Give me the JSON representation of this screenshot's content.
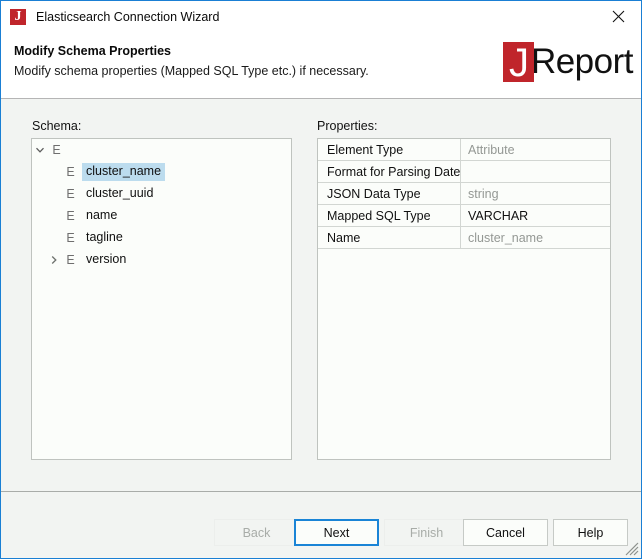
{
  "window": {
    "title": "Elasticsearch Connection Wizard",
    "app_icon": "jreport-j-icon",
    "close_icon": "close-icon",
    "accent_color": "#1a7fd4",
    "brand_red": "#c0252b",
    "selection_color": "#bcdcee"
  },
  "header": {
    "title": "Modify Schema Properties",
    "subtitle": "Modify schema properties (Mapped SQL Type etc.) if necessary.",
    "logo_mark": "J",
    "logo_word": "Report"
  },
  "schema": {
    "label": "Schema:",
    "tree": [
      {
        "label": "",
        "tag": "E",
        "level": 0,
        "expanded": true,
        "has_children": true,
        "selected": false
      },
      {
        "label": "cluster_name",
        "tag": "E",
        "level": 1,
        "expanded": false,
        "has_children": false,
        "selected": true
      },
      {
        "label": "cluster_uuid",
        "tag": "E",
        "level": 1,
        "expanded": false,
        "has_children": false,
        "selected": false
      },
      {
        "label": "name",
        "tag": "E",
        "level": 1,
        "expanded": false,
        "has_children": false,
        "selected": false
      },
      {
        "label": "tagline",
        "tag": "E",
        "level": 1,
        "expanded": false,
        "has_children": false,
        "selected": false
      },
      {
        "label": "version",
        "tag": "E",
        "level": 1,
        "expanded": false,
        "has_children": true,
        "selected": false
      }
    ]
  },
  "properties": {
    "label": "Properties:",
    "rows": [
      {
        "name": "Element Type",
        "value": "Attribute",
        "editable": false
      },
      {
        "name": "Format for Parsing Date/T...",
        "value": "",
        "editable": true
      },
      {
        "name": "JSON Data Type",
        "value": "string",
        "editable": false
      },
      {
        "name": "Mapped SQL Type",
        "value": "VARCHAR",
        "editable": true
      },
      {
        "name": "Name",
        "value": "cluster_name",
        "editable": false
      }
    ]
  },
  "footer": {
    "buttons": [
      {
        "id": "back",
        "label": "Back",
        "state": "disabled"
      },
      {
        "id": "next",
        "label": "Next",
        "state": "focused"
      },
      {
        "id": "finish",
        "label": "Finish",
        "state": "disabled"
      },
      {
        "id": "cancel",
        "label": "Cancel",
        "state": "normal"
      },
      {
        "id": "help",
        "label": "Help",
        "state": "normal"
      }
    ]
  }
}
